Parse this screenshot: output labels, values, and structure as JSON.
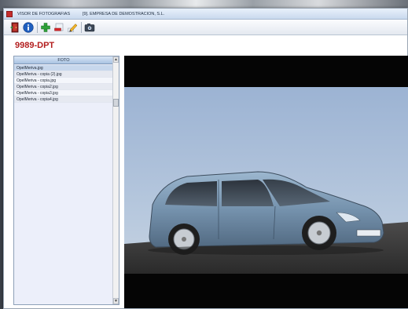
{
  "window": {
    "title": "VISOR DE FOTOGRAFIAS",
    "company": "[9]. EMPRESA DE DEMOSTRACION, S.L."
  },
  "toolbar": {
    "buttons": [
      {
        "icon": "exit-door-icon"
      },
      {
        "icon": "info-icon"
      },
      {
        "icon": "add-icon"
      },
      {
        "icon": "remove-icon"
      },
      {
        "icon": "edit-pencil-icon"
      },
      {
        "icon": "camera-icon"
      }
    ]
  },
  "vehicle": {
    "plate": "9989-DPT"
  },
  "photo_list": {
    "header": "FOTO",
    "items": [
      {
        "label": "OpelMeriva.jpg"
      },
      {
        "label": "OpelMeriva - copia (2).jpg"
      },
      {
        "label": "OpelMeriva - copia.jpg"
      },
      {
        "label": "OpelMeriva - copia2.jpg"
      },
      {
        "label": "OpelMeriva - copia3.jpg"
      },
      {
        "label": "OpelMeriva - copia4.jpg"
      }
    ],
    "selected_index": 0
  },
  "viewer": {
    "image_subject": "silver-blue minivan car photo"
  },
  "colors": {
    "plate_text": "#b31e1e",
    "list_header": "#a9c3e2",
    "photo_background": "#050505"
  }
}
